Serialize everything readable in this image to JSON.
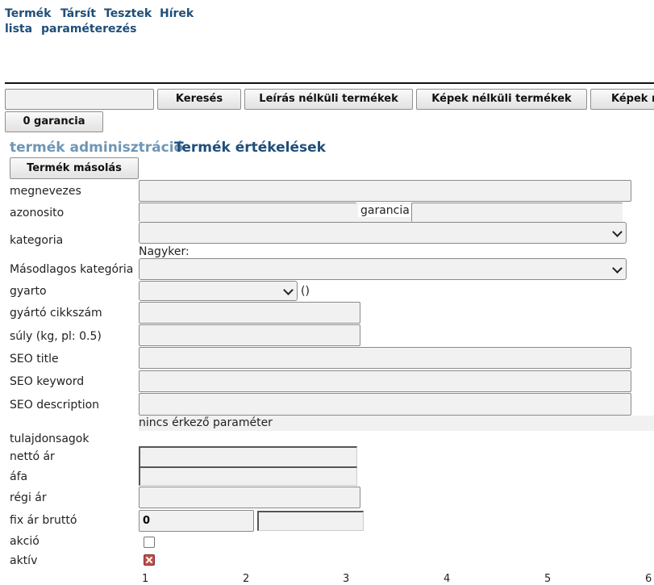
{
  "nav": {
    "top": [
      "Termék",
      "Társít",
      "Tesztek",
      "Hírek"
    ],
    "second": [
      "lista",
      "paraméterezés"
    ]
  },
  "toolbar": {
    "search_value": "",
    "search_button": "Keresés",
    "no_description_button": "Leírás nélküli termékek",
    "no_image_button": "Képek nélküli termékek",
    "truncated_button": "Képek n",
    "guarantee_button": "0 garancia"
  },
  "tabs": {
    "admin": "termék adminisztráció",
    "ratings": "Termék értékelések"
  },
  "copy_button": "Termék másolás",
  "form": {
    "labels": {
      "name": "megnevezes",
      "id": "azonosito",
      "category": "kategoria",
      "secondary_category": "Másodlagos kategória",
      "manufacturer": "gyarto",
      "mfr_sku": "gyártó cikkszám",
      "weight": "súly (kg, pl: 0.5)",
      "seo_title": "SEO title",
      "seo_keyword": "SEO keyword",
      "seo_description": "SEO description",
      "properties": "tulajdonsagok",
      "net_price": "nettó ár",
      "vat": "áfa",
      "old_price": "régi ár",
      "fixed_gross": "fix ár bruttó",
      "sale": "akció",
      "active": "aktív"
    },
    "guarantee_label": "garancia",
    "wholesale_label": "Nagyker:",
    "manufacturer_suffix": "()",
    "no_param": "nincs érkező paraméter",
    "fixed_gross_value": "0",
    "sale_checked": false,
    "active_checked": true
  },
  "scale_numbers": [
    "1",
    "2",
    "3",
    "4",
    "5",
    "6"
  ]
}
